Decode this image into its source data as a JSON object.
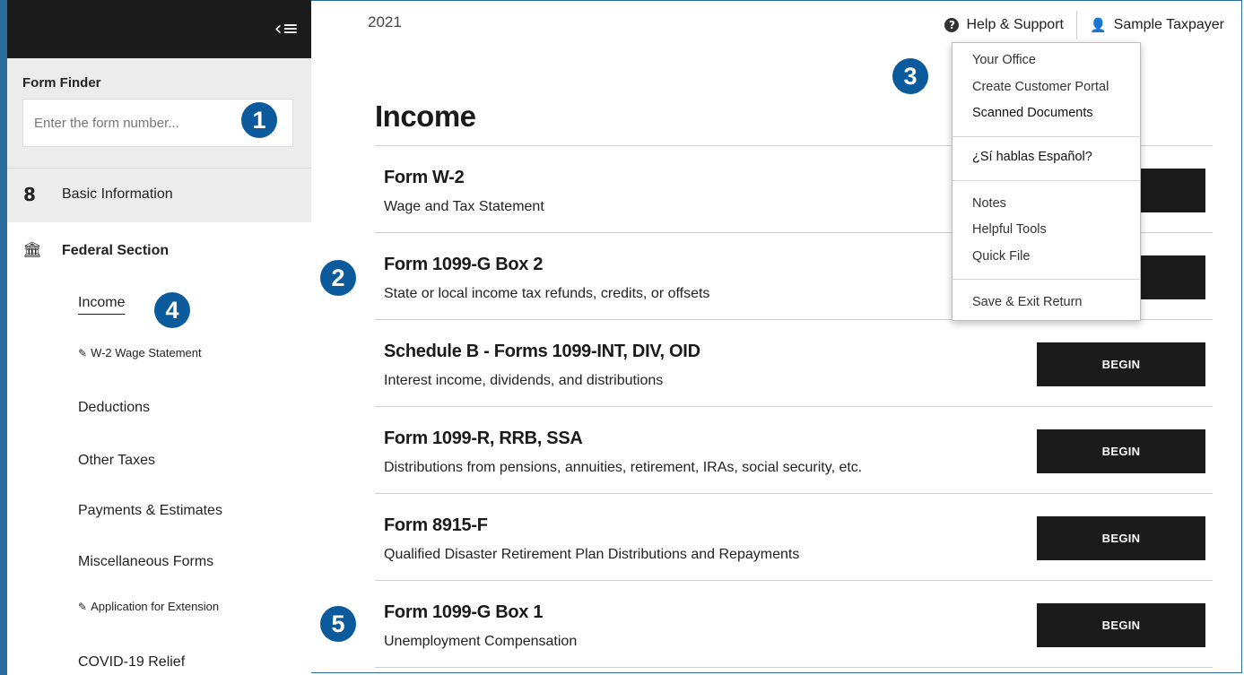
{
  "header": {
    "year": "2021",
    "help_label": "Help & Support",
    "user_label": "Sample Taxpayer",
    "collapse_icon": "‹≡"
  },
  "sidebar": {
    "finder_label": "Form Finder",
    "finder_placeholder": "Enter the form number...",
    "basic_info": "Basic Information",
    "federal_section": "Federal Section",
    "items": [
      {
        "label": "Income"
      },
      {
        "label": "W-2 Wage Statement"
      },
      {
        "label": "Deductions"
      },
      {
        "label": "Other Taxes"
      },
      {
        "label": "Payments & Estimates"
      },
      {
        "label": "Miscellaneous Forms"
      },
      {
        "label": "Application for Extension"
      },
      {
        "label": "COVID-19 Relief"
      }
    ]
  },
  "main": {
    "title": "Income",
    "begin_label": "BEGIN",
    "forms": [
      {
        "title": "Form W-2",
        "desc": "Wage and Tax Statement"
      },
      {
        "title": "Form 1099-G Box 2",
        "desc": "State or local income tax refunds, credits, or offsets"
      },
      {
        "title": "Schedule B - Forms 1099-INT, DIV, OID",
        "desc": "Interest income, dividends, and distributions"
      },
      {
        "title": "Form 1099-R, RRB, SSA",
        "desc": "Distributions from pensions, annuities, retirement, IRAs, social security, etc."
      },
      {
        "title": "Form 8915-F",
        "desc": "Qualified Disaster Retirement Plan Distributions and Repayments"
      },
      {
        "title": "Form 1099-G Box 1",
        "desc": "Unemployment Compensation"
      }
    ]
  },
  "dropdown": {
    "items": [
      "Your Office",
      "Create Customer Portal",
      "Scanned Documents",
      "¿Sí hablas Español?",
      "Notes",
      "Helpful Tools",
      "Quick File",
      "Save & Exit Return"
    ]
  },
  "callouts": [
    "1",
    "2",
    "3",
    "4",
    "5"
  ],
  "colors": {
    "accent": "#0b5a9c",
    "button_bg": "#1b1b1b",
    "sidebar_gray": "#ececec"
  }
}
